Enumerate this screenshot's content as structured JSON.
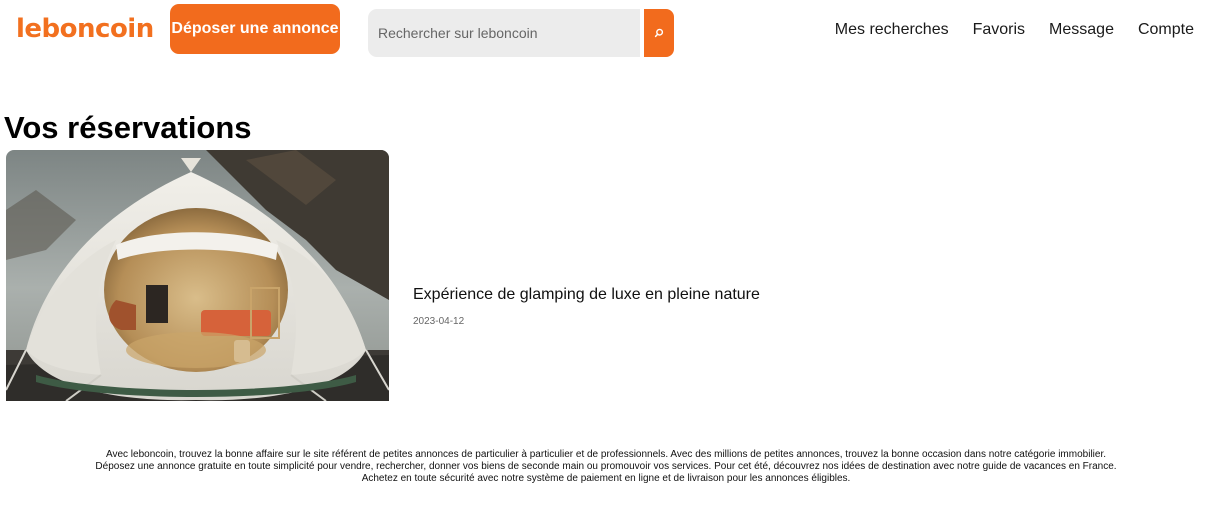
{
  "header": {
    "logo": "leboncoin",
    "deposit_label": "Déposer une annonce",
    "search_placeholder": "Rechercher sur leboncoin",
    "search_icon": "search-icon",
    "nav": [
      "Mes recherches",
      "Favoris",
      "Message",
      "Compte"
    ]
  },
  "main": {
    "title": "Vos réservations",
    "reservations": [
      {
        "title": "Expérience de glamping de luxe en pleine nature",
        "date": "2023-04-12",
        "image": "glamping-tent-photo"
      }
    ]
  },
  "footer": {
    "lines": [
      "Avec leboncoin, trouvez la bonne affaire sur le site référent de petites annonces de particulier à particulier et de professionnels. Avec des millions de petites annonces, trouvez la bonne occasion dans notre catégorie immobilier.",
      "Déposez une annonce gratuite en toute simplicité pour vendre, rechercher, donner vos biens de seconde main ou promouvoir vos services. Pour cet été, découvrez nos idées de destination avec notre guide de vacances en France.",
      "Achetez en toute sécurité avec notre système de paiement en ligne et de livraison pour les annonces éligibles."
    ]
  },
  "colors": {
    "brand": "#f26b1d",
    "search_bg": "#ececec"
  }
}
